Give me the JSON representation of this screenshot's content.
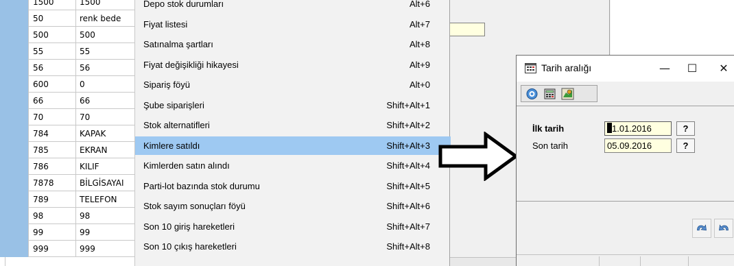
{
  "grid": {
    "rows": [
      {
        "code": "1500",
        "name": "1500"
      },
      {
        "code": "50",
        "name": "renk bede"
      },
      {
        "code": "500",
        "name": "500"
      },
      {
        "code": "55",
        "name": "55"
      },
      {
        "code": "56",
        "name": "56"
      },
      {
        "code": "600",
        "name": "0"
      },
      {
        "code": "66",
        "name": "66"
      },
      {
        "code": "70",
        "name": "70"
      },
      {
        "code": "784",
        "name": "KAPAK"
      },
      {
        "code": "785",
        "name": "EKRAN"
      },
      {
        "code": "786",
        "name": "KILIF"
      },
      {
        "code": "7878",
        "name": "BİLGİSAYAI"
      },
      {
        "code": "789",
        "name": "TELEFON"
      },
      {
        "code": "98",
        "name": "98"
      },
      {
        "code": "99",
        "name": "99"
      },
      {
        "code": "999",
        "name": "999"
      }
    ]
  },
  "menu": {
    "items": [
      {
        "label": "Depo stok durumları",
        "shortcut": "Alt+6"
      },
      {
        "label": "Fiyat listesi",
        "shortcut": "Alt+7"
      },
      {
        "label": "Satınalma şartları",
        "shortcut": "Alt+8"
      },
      {
        "label": "Fiyat değişikliği hikayesi",
        "shortcut": "Alt+9"
      },
      {
        "label": "Sipariş föyü",
        "shortcut": "Alt+0"
      },
      {
        "label": "Şube siparişleri",
        "shortcut": "Shift+Alt+1"
      },
      {
        "label": "Stok alternatifleri",
        "shortcut": "Shift+Alt+2"
      },
      {
        "label": "Kimlere satıldı",
        "shortcut": "Shift+Alt+3"
      },
      {
        "label": "Kimlerden satın alındı",
        "shortcut": "Shift+Alt+4"
      },
      {
        "label": "Parti-lot bazında stok durumu",
        "shortcut": "Shift+Alt+5"
      },
      {
        "label": "Stok sayım sonuçları föyü",
        "shortcut": "Shift+Alt+6"
      },
      {
        "label": "Son 10 giriş hareketleri",
        "shortcut": "Shift+Alt+7"
      },
      {
        "label": "Son 10 çıkış hareketleri",
        "shortcut": "Shift+Alt+8"
      }
    ],
    "highlighted_index": 7
  },
  "dialog": {
    "title": "Tarih aralığı",
    "minimize": "—",
    "maximize": "☐",
    "close": "✕",
    "start_label": "İlk tarih",
    "start_value": "01.01.2016",
    "start_value_rest": "1.01.2016",
    "start_caret_char": "0",
    "end_label": "Son tarih",
    "end_value": "05.09.2016",
    "lookup_label": "?",
    "icons": [
      "help-icon",
      "calculator-icon",
      "chart-icon",
      "confirm-icon",
      "cancel-icon"
    ]
  },
  "colors": {
    "highlight": "#9ec9f2",
    "grid_selector": "#99c1e6",
    "input_bg": "#ffffe0"
  }
}
